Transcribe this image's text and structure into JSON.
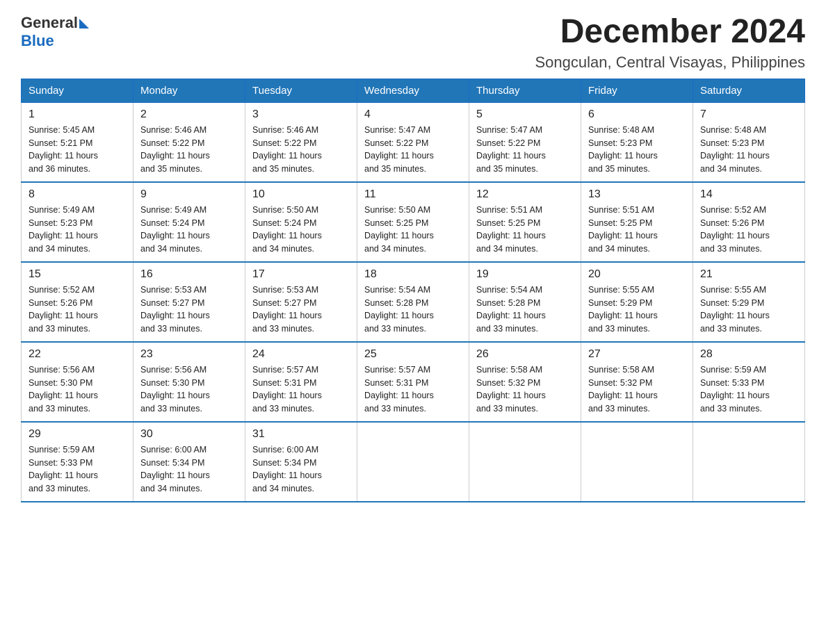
{
  "header": {
    "logo_text_general": "General",
    "logo_text_blue": "Blue",
    "title": "December 2024",
    "subtitle": "Songculan, Central Visayas, Philippines"
  },
  "days_of_week": [
    "Sunday",
    "Monday",
    "Tuesday",
    "Wednesday",
    "Thursday",
    "Friday",
    "Saturday"
  ],
  "weeks": [
    [
      {
        "day": "1",
        "sunrise": "5:45 AM",
        "sunset": "5:21 PM",
        "daylight": "11 hours and 36 minutes."
      },
      {
        "day": "2",
        "sunrise": "5:46 AM",
        "sunset": "5:22 PM",
        "daylight": "11 hours and 35 minutes."
      },
      {
        "day": "3",
        "sunrise": "5:46 AM",
        "sunset": "5:22 PM",
        "daylight": "11 hours and 35 minutes."
      },
      {
        "day": "4",
        "sunrise": "5:47 AM",
        "sunset": "5:22 PM",
        "daylight": "11 hours and 35 minutes."
      },
      {
        "day": "5",
        "sunrise": "5:47 AM",
        "sunset": "5:22 PM",
        "daylight": "11 hours and 35 minutes."
      },
      {
        "day": "6",
        "sunrise": "5:48 AM",
        "sunset": "5:23 PM",
        "daylight": "11 hours and 35 minutes."
      },
      {
        "day": "7",
        "sunrise": "5:48 AM",
        "sunset": "5:23 PM",
        "daylight": "11 hours and 34 minutes."
      }
    ],
    [
      {
        "day": "8",
        "sunrise": "5:49 AM",
        "sunset": "5:23 PM",
        "daylight": "11 hours and 34 minutes."
      },
      {
        "day": "9",
        "sunrise": "5:49 AM",
        "sunset": "5:24 PM",
        "daylight": "11 hours and 34 minutes."
      },
      {
        "day": "10",
        "sunrise": "5:50 AM",
        "sunset": "5:24 PM",
        "daylight": "11 hours and 34 minutes."
      },
      {
        "day": "11",
        "sunrise": "5:50 AM",
        "sunset": "5:25 PM",
        "daylight": "11 hours and 34 minutes."
      },
      {
        "day": "12",
        "sunrise": "5:51 AM",
        "sunset": "5:25 PM",
        "daylight": "11 hours and 34 minutes."
      },
      {
        "day": "13",
        "sunrise": "5:51 AM",
        "sunset": "5:25 PM",
        "daylight": "11 hours and 34 minutes."
      },
      {
        "day": "14",
        "sunrise": "5:52 AM",
        "sunset": "5:26 PM",
        "daylight": "11 hours and 33 minutes."
      }
    ],
    [
      {
        "day": "15",
        "sunrise": "5:52 AM",
        "sunset": "5:26 PM",
        "daylight": "11 hours and 33 minutes."
      },
      {
        "day": "16",
        "sunrise": "5:53 AM",
        "sunset": "5:27 PM",
        "daylight": "11 hours and 33 minutes."
      },
      {
        "day": "17",
        "sunrise": "5:53 AM",
        "sunset": "5:27 PM",
        "daylight": "11 hours and 33 minutes."
      },
      {
        "day": "18",
        "sunrise": "5:54 AM",
        "sunset": "5:28 PM",
        "daylight": "11 hours and 33 minutes."
      },
      {
        "day": "19",
        "sunrise": "5:54 AM",
        "sunset": "5:28 PM",
        "daylight": "11 hours and 33 minutes."
      },
      {
        "day": "20",
        "sunrise": "5:55 AM",
        "sunset": "5:29 PM",
        "daylight": "11 hours and 33 minutes."
      },
      {
        "day": "21",
        "sunrise": "5:55 AM",
        "sunset": "5:29 PM",
        "daylight": "11 hours and 33 minutes."
      }
    ],
    [
      {
        "day": "22",
        "sunrise": "5:56 AM",
        "sunset": "5:30 PM",
        "daylight": "11 hours and 33 minutes."
      },
      {
        "day": "23",
        "sunrise": "5:56 AM",
        "sunset": "5:30 PM",
        "daylight": "11 hours and 33 minutes."
      },
      {
        "day": "24",
        "sunrise": "5:57 AM",
        "sunset": "5:31 PM",
        "daylight": "11 hours and 33 minutes."
      },
      {
        "day": "25",
        "sunrise": "5:57 AM",
        "sunset": "5:31 PM",
        "daylight": "11 hours and 33 minutes."
      },
      {
        "day": "26",
        "sunrise": "5:58 AM",
        "sunset": "5:32 PM",
        "daylight": "11 hours and 33 minutes."
      },
      {
        "day": "27",
        "sunrise": "5:58 AM",
        "sunset": "5:32 PM",
        "daylight": "11 hours and 33 minutes."
      },
      {
        "day": "28",
        "sunrise": "5:59 AM",
        "sunset": "5:33 PM",
        "daylight": "11 hours and 33 minutes."
      }
    ],
    [
      {
        "day": "29",
        "sunrise": "5:59 AM",
        "sunset": "5:33 PM",
        "daylight": "11 hours and 33 minutes."
      },
      {
        "day": "30",
        "sunrise": "6:00 AM",
        "sunset": "5:34 PM",
        "daylight": "11 hours and 34 minutes."
      },
      {
        "day": "31",
        "sunrise": "6:00 AM",
        "sunset": "5:34 PM",
        "daylight": "11 hours and 34 minutes."
      },
      null,
      null,
      null,
      null
    ]
  ],
  "labels": {
    "sunrise": "Sunrise:",
    "sunset": "Sunset:",
    "daylight": "Daylight:"
  }
}
